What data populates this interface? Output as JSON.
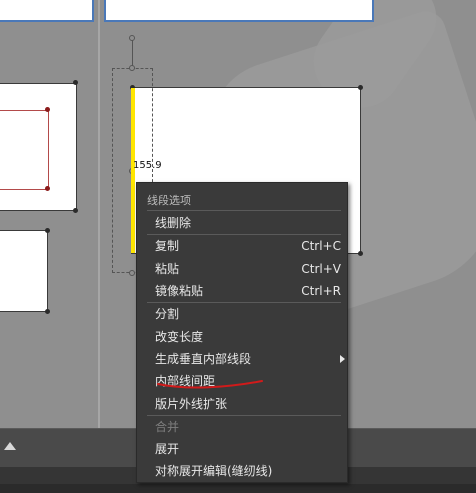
{
  "canvas": {
    "dimension_label": "155.9"
  },
  "context_menu": {
    "title": "线段选项",
    "items": [
      {
        "label": "线删除",
        "shortcut": "",
        "enabled": true
      },
      {
        "label": "复制",
        "shortcut": "Ctrl+C",
        "enabled": true
      },
      {
        "label": "粘贴",
        "shortcut": "Ctrl+V",
        "enabled": true
      },
      {
        "label": "镜像粘贴",
        "shortcut": "Ctrl+R",
        "enabled": true
      },
      {
        "label": "分割",
        "shortcut": "",
        "enabled": true
      },
      {
        "label": "改变长度",
        "shortcut": "",
        "enabled": true
      },
      {
        "label": "生成垂直内部线段",
        "shortcut": "",
        "enabled": true,
        "submenu": true
      },
      {
        "label": "内部线间距",
        "shortcut": "",
        "enabled": true
      },
      {
        "label": "版片外线扩张",
        "shortcut": "",
        "enabled": true
      },
      {
        "label": "合并",
        "shortcut": "",
        "enabled": false
      },
      {
        "label": "展开",
        "shortcut": "",
        "enabled": true
      },
      {
        "label": "对称展开编辑(缝纫线)",
        "shortcut": "",
        "enabled": true
      }
    ]
  },
  "colors": {
    "selected_line": "#ffe600",
    "annotation_underline": "#d11a1a",
    "menu_bg": "#3a3a3a"
  }
}
